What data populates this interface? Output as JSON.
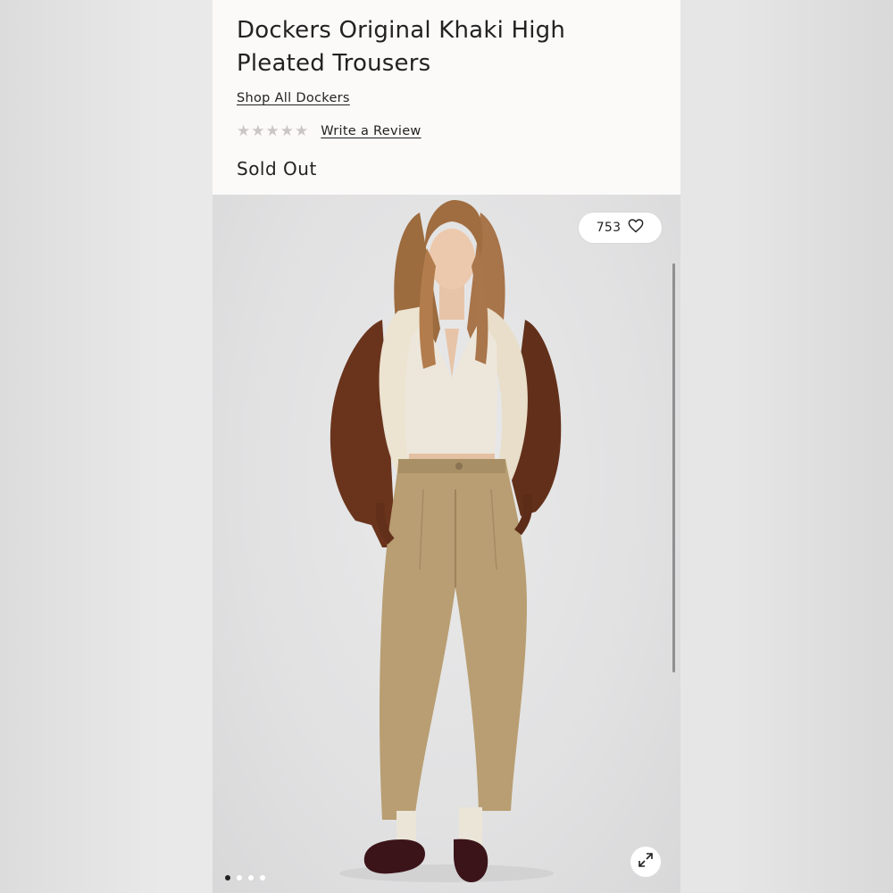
{
  "product": {
    "title": "Dockers Original Khaki High Pleated Trousers",
    "shop_link": "Shop All Dockers",
    "rating": {
      "stars_filled": 0,
      "stars_total": 5
    },
    "review_link": "Write a Review",
    "status": "Sold Out"
  },
  "gallery": {
    "like_count": "753",
    "like_icon": "heart-outline-icon",
    "expand_icon": "expand-arrows-icon",
    "slide_count": 4,
    "active_slide": 1
  },
  "colors": {
    "page_bg": "#fcfaf9",
    "text": "#222222",
    "star_empty": "#c9c6c4",
    "pants": "#b89e72",
    "jacket": "#6a341c",
    "shearling": "#ece3d1"
  }
}
